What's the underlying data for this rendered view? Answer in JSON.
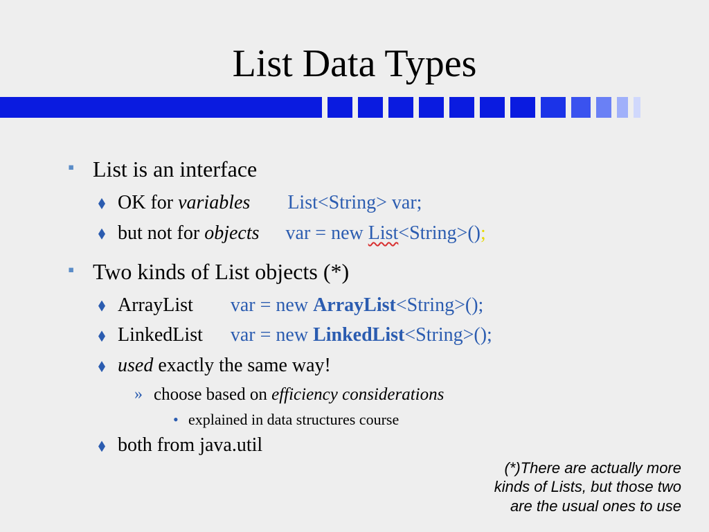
{
  "title": "List Data Types",
  "band_colors": [
    "#0a1be0",
    "#0a1be0",
    "#0a1be0",
    "#0a1be0",
    "#0a1be0",
    "#0a1be0",
    "#0a1be0",
    "#1b33e8",
    "#3a52ef",
    "#6a80f5",
    "#a0b0fa",
    "#d0d8fc",
    "#ecf0fe"
  ],
  "b1": {
    "h": "List is an interface",
    "s1_pre": "OK for ",
    "s1_it": "variables",
    "s1_code": "List<String> var;",
    "s2_pre": "but not for ",
    "s2_it": "objects",
    "s2_a": "var = new ",
    "s2_u": "List",
    "s2_b": "<String>()",
    "s2_semi": ";"
  },
  "b2": {
    "h": "Two kinds of List objects (*)",
    "s1_lbl": "ArrayList",
    "s1_a": "var = new ",
    "s1_b": "ArrayList",
    "s1_c": "<String>();",
    "s2_lbl": "LinkedList",
    "s2_a": "var = new ",
    "s2_b": "LinkedList",
    "s2_c": "<String>();",
    "s3_it": "used",
    "s3_t": " exactly the same way!",
    "s3a_pre": "choose based on ",
    "s3a_it": "efficiency considerations",
    "s3b": "explained in data structures course",
    "s4": "both from java.util"
  },
  "footnote": "(*)There are actually more kinds of Lists, but those two are the usual ones to use"
}
